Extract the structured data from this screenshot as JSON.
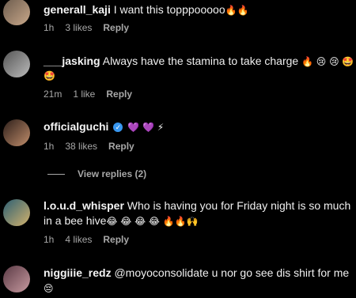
{
  "comments": [
    {
      "username": "generall_kaji",
      "text": "I want this topppooooo",
      "emojis": "🔥🔥",
      "time": "1h",
      "likes": "3 likes",
      "reply": "Reply"
    },
    {
      "username": "___jasking",
      "text": "Always have the stamina to take charge",
      "emojis": " 🔥 😢 😢 🤩",
      "emojis2": "🤩",
      "time": "21m",
      "likes": "1 like",
      "reply": "Reply"
    },
    {
      "username": "officialguchi",
      "emojis": "💜 💜 ⚡",
      "time": "1h",
      "likes": "38 likes",
      "reply": "Reply",
      "view_replies": "View replies (2)"
    },
    {
      "username": "l.o.u.d_whisper",
      "text": "Who is having you for Friday night is so much in a bee hive",
      "emojis": "😂 😂 😂 😂 🔥🔥🙌",
      "time": "1h",
      "likes": "4 likes",
      "reply": "Reply"
    },
    {
      "username": "niggiiie_redz",
      "text": "@moyoconsolidate u nor go see dis shirt for me",
      "emojis": "😔"
    }
  ]
}
